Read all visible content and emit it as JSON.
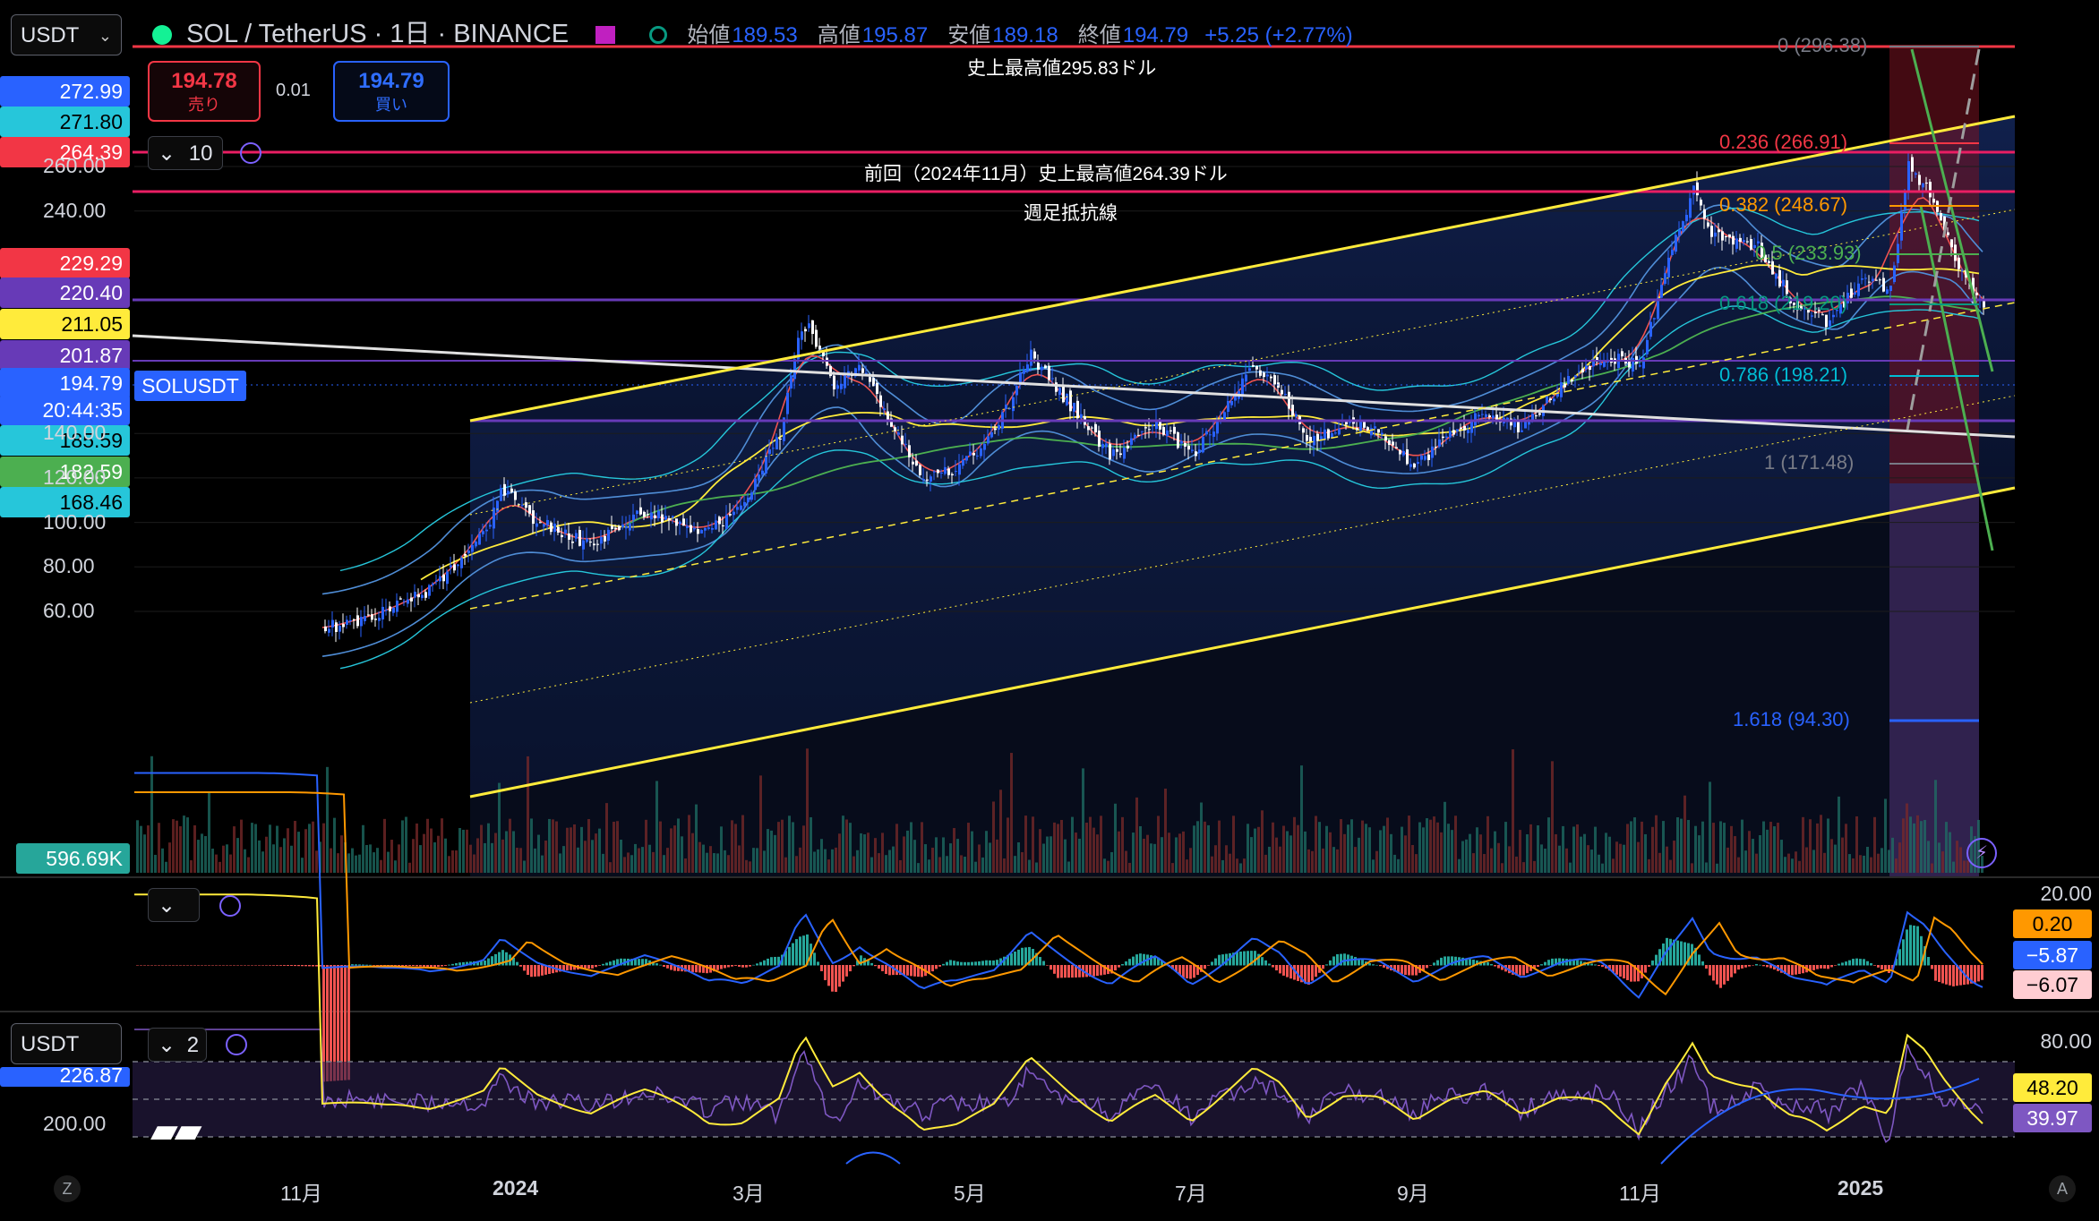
{
  "toolbar": {
    "currency": "USDT",
    "currency_lower": "USDT"
  },
  "legend": {
    "title": "SOL / TetherUS · 1日 · BINANCE",
    "open_label": "始値",
    "open": "189.53",
    "high_label": "高値",
    "high": "195.87",
    "low_label": "安値",
    "low": "189.18",
    "close_label": "終値",
    "close": "194.79",
    "change": "+5.25 (+2.77%)"
  },
  "trade": {
    "sell_price": "194.78",
    "sell_label": "売り",
    "spread": "0.01",
    "buy_price": "194.79",
    "buy_label": "買い"
  },
  "indicator_toggle": {
    "count_main": "10",
    "count_lower": "2"
  },
  "annotations": {
    "ath": "史上最高値295.83ドル",
    "prev_ath": "前回（2024年11月）史上最高値264.39ドル",
    "weekly_resistance": "週足抵抗線"
  },
  "fib_levels": [
    {
      "label": "0 (296.38)",
      "color": "#787b86"
    },
    {
      "label": "0.236 (266.91)",
      "color": "#f23645"
    },
    {
      "label": "0.382 (248.67)",
      "color": "#ff9800"
    },
    {
      "label": "0.5 (233.93)",
      "color": "#4caf50"
    },
    {
      "label": "0.618 (219.20)",
      "color": "#089981"
    },
    {
      "label": "0.786 (198.21)",
      "color": "#00bcd4"
    },
    {
      "label": "1 (171.48)",
      "color": "#787b86"
    },
    {
      "label": "1.618 (94.30)",
      "color": "#2962ff"
    }
  ],
  "left_labels": [
    {
      "text": "272.99",
      "bg": "#2962ff",
      "fg": "#ffffff"
    },
    {
      "text": "271.80",
      "bg": "#26c6da",
      "fg": "#000000"
    },
    {
      "text": "264.39",
      "bg": "#f23645",
      "fg": "#ffffff"
    },
    {
      "text": "229.29",
      "bg": "#f23645",
      "fg": "#ffffff"
    },
    {
      "text": "220.40",
      "bg": "#673ab7",
      "fg": "#ffffff"
    },
    {
      "text": "211.05",
      "bg": "#ffeb3b",
      "fg": "#000000"
    },
    {
      "text": "201.87",
      "bg": "#673ab7",
      "fg": "#ffffff"
    },
    {
      "text": "194.79",
      "bg": "#2962ff",
      "fg": "#ffffff"
    },
    {
      "text": "20:44:35",
      "bg": "#2962ff",
      "fg": "#ffffff"
    },
    {
      "text": "185.59",
      "bg": "#26c6da",
      "fg": "#000000"
    },
    {
      "text": "182.59",
      "bg": "#4caf50",
      "fg": "#ffffff"
    },
    {
      "text": "168.46",
      "bg": "#26c6da",
      "fg": "#000000"
    },
    {
      "text": "596.69K",
      "bg": "#26a69a",
      "fg": "#ffffff"
    }
  ],
  "symbol_tag": "SOLUSDT",
  "price_axis": [
    "260.00",
    "240.00",
    "140.00",
    "120.00",
    "100.00",
    "80.00",
    "60.00"
  ],
  "macd_axis": {
    "top": "20.00",
    "labels": [
      {
        "text": "0.20",
        "bg": "#ff9800",
        "fg": "#000000"
      },
      {
        "text": "−5.87",
        "bg": "#2962ff",
        "fg": "#ffffff"
      },
      {
        "text": "−6.07",
        "bg": "#ffcdd2",
        "fg": "#000000"
      }
    ]
  },
  "rsi_axis": {
    "top": "80.00",
    "labels": [
      {
        "text": "48.20",
        "bg": "#ffeb3b",
        "fg": "#000000"
      },
      {
        "text": "39.97",
        "bg": "#7e57c2",
        "fg": "#ffffff"
      }
    ]
  },
  "lower_left": {
    "partial_value": "226.87",
    "value": "200.00"
  },
  "time_axis": [
    "11月",
    "2024",
    "3月",
    "5月",
    "7月",
    "9月",
    "11月",
    "2025"
  ],
  "footer": {
    "left": "Z",
    "right": "A"
  }
}
